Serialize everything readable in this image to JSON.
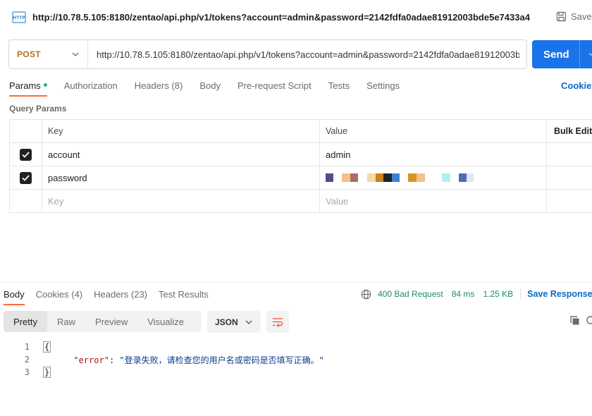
{
  "title_bar": {
    "url": "http://10.78.5.105:8180/zentao/api.php/v1/tokens?account=admin&password=2142fdfa0adae81912003bde5e7433a4",
    "save_label": "Save"
  },
  "request": {
    "method": "POST",
    "url_value": "http://10.78.5.105:8180/zentao/api.php/v1/tokens?account=admin&password=2142fdfa0adae81912003bde5e7433a4",
    "send_label": "Send"
  },
  "request_tabs": [
    {
      "label": "Params",
      "count": ""
    },
    {
      "label": "Authorization",
      "count": ""
    },
    {
      "label": "Headers",
      "count": "(8)"
    },
    {
      "label": "Body",
      "count": ""
    },
    {
      "label": "Pre-request Script",
      "count": ""
    },
    {
      "label": "Tests",
      "count": ""
    },
    {
      "label": "Settings",
      "count": ""
    }
  ],
  "cookies_link": "Cookies",
  "query_params_title": "Query Params",
  "params_table": {
    "headers": {
      "key": "Key",
      "value": "Value",
      "bulk_edit": "Bulk Edit"
    },
    "rows": [
      {
        "key": "account",
        "value": "admin",
        "checked": true
      },
      {
        "key": "password",
        "value": "",
        "checked": true
      }
    ],
    "key_placeholder": "Key",
    "value_placeholder": "Value"
  },
  "response_tabs": [
    {
      "label": "Body",
      "count": ""
    },
    {
      "label": "Cookies",
      "count": "(4)"
    },
    {
      "label": "Headers",
      "count": "(23)"
    },
    {
      "label": "Test Results",
      "count": ""
    }
  ],
  "response_status": {
    "status": "400 Bad Request",
    "time": "84 ms",
    "size": "1.25 KB",
    "save_label": "Save Response"
  },
  "view_modes": [
    "Pretty",
    "Raw",
    "Preview",
    "Visualize"
  ],
  "format": "JSON",
  "code_lines": {
    "line_numbers": [
      "1",
      "2",
      "3"
    ],
    "open_brace": "{",
    "close_brace": "}",
    "error_key": "\"error\"",
    "separator": ": ",
    "error_value": "\"登录失败，请检查您的用户名或密码是否填写正确。\""
  },
  "colors": {
    "accent_blue": "#1a73e8",
    "method_orange": "#b7701d",
    "tab_underline": "#ff6c37",
    "status_green": "#1b8f66",
    "link_blue": "#0b6ac7"
  }
}
